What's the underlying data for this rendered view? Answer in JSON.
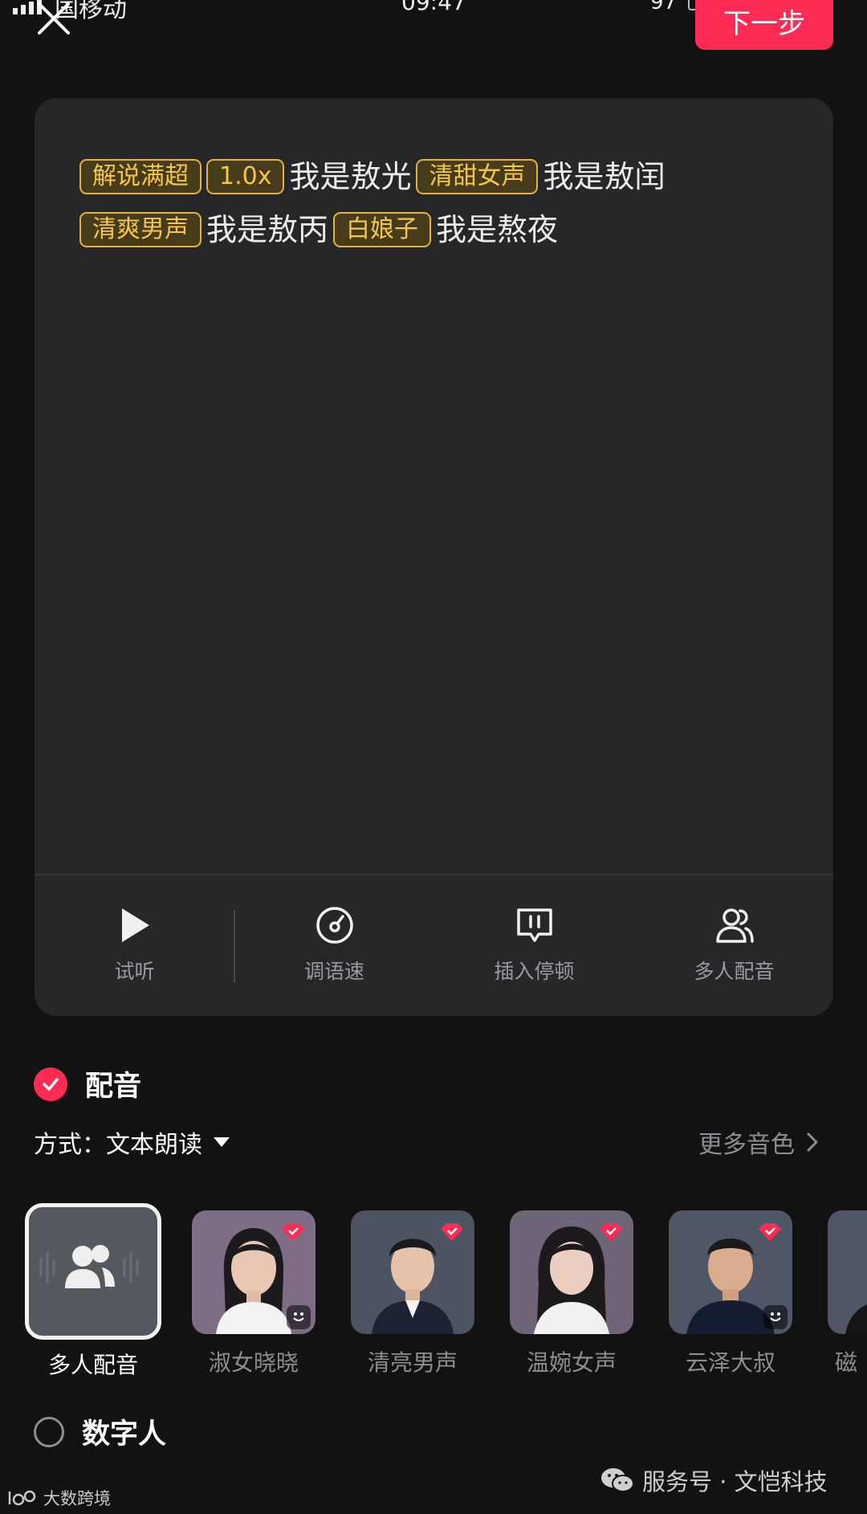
{
  "status_bar": {
    "carrier": "国移动",
    "time": "09:47",
    "battery": "97"
  },
  "header": {
    "next_label": "下一步"
  },
  "editor": {
    "segments": [
      {
        "type": "tag",
        "text": "解说满超"
      },
      {
        "type": "tag",
        "text": "1.0x"
      },
      {
        "type": "text",
        "text": "我是敖光"
      },
      {
        "type": "tag",
        "text": "清甜女声"
      },
      {
        "type": "text",
        "text": "我是敖闰"
      },
      {
        "type": "tag",
        "text": "清爽男声"
      },
      {
        "type": "text",
        "text": "我是敖丙"
      },
      {
        "type": "tag",
        "text": "白娘子"
      },
      {
        "type": "text",
        "text": "我是熬夜"
      }
    ],
    "tag_color": "#f4c54a"
  },
  "toolbar": {
    "items": [
      {
        "label": "试听",
        "icon": "play-icon"
      },
      {
        "label": "调语速",
        "icon": "speed-dial-icon"
      },
      {
        "label": "插入停顿",
        "icon": "pause-insert-icon"
      },
      {
        "label": "多人配音",
        "icon": "multi-person-icon"
      }
    ]
  },
  "dubbing": {
    "label": "配音",
    "checked": true
  },
  "mode": {
    "prefix": "方式：",
    "value": "文本朗读"
  },
  "more_voices": {
    "label": "更多音色"
  },
  "voices": [
    {
      "name": "多人配音",
      "selected": true
    },
    {
      "name": "淑女晓晓",
      "selected": false
    },
    {
      "name": "清亮男声",
      "selected": false
    },
    {
      "name": "温婉女声",
      "selected": false
    },
    {
      "name": "云泽大叔",
      "selected": false
    },
    {
      "name": "磁",
      "selected": false
    }
  ],
  "digital_human": {
    "label": "数字人",
    "checked": false
  },
  "footer": {
    "wechat": "服务号 · 文恺科技",
    "watermark": "大数跨境"
  },
  "colors": {
    "accent": "#fe2c55",
    "background": "#121212",
    "panel": "#27272a"
  }
}
